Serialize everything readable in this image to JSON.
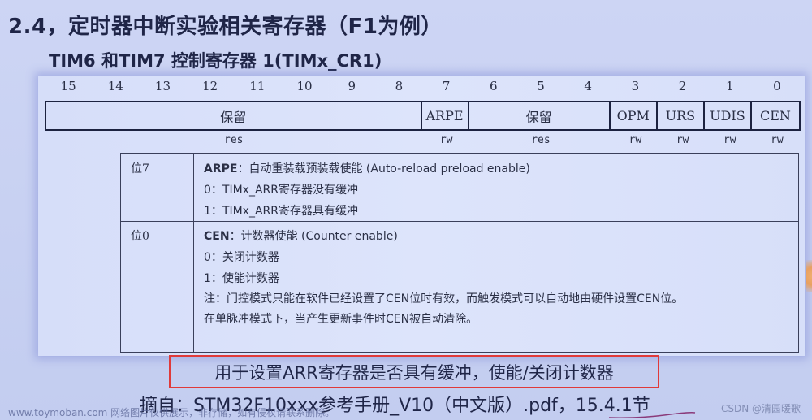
{
  "slide": {
    "title": "2.4，定时器中断实验相关寄存器（F1为例）",
    "subtitle": "TIM6 和TIM7 控制寄存器 1(TIMx_CR1)"
  },
  "register": {
    "bit_numbers": [
      "15",
      "14",
      "13",
      "12",
      "11",
      "10",
      "9",
      "8",
      "7",
      "6",
      "5",
      "4",
      "3",
      "2",
      "1",
      "0"
    ],
    "fields": [
      {
        "name": "保留",
        "bits": "15-8",
        "span": 8,
        "access": "res"
      },
      {
        "name": "ARPE",
        "bits": "7",
        "span": 1,
        "access": "rw"
      },
      {
        "name": "保留",
        "bits": "6-4",
        "span": 3,
        "access": "res"
      },
      {
        "name": "OPM",
        "bits": "3",
        "span": 1,
        "access": "rw"
      },
      {
        "name": "URS",
        "bits": "2",
        "span": 1,
        "access": "rw"
      },
      {
        "name": "UDIS",
        "bits": "1",
        "span": 1,
        "access": "rw"
      },
      {
        "name": "CEN",
        "bits": "0",
        "span": 1,
        "access": "rw"
      }
    ]
  },
  "descriptions": [
    {
      "label": "位7",
      "field": "ARPE",
      "heading": "：自动重装载预装载使能 (Auto-reload preload enable)",
      "lines": [
        "0：TIMx_ARR寄存器没有缓冲",
        "1：TIMx_ARR寄存器具有缓冲"
      ]
    },
    {
      "label": "位0",
      "field": "CEN",
      "heading": "：计数器使能 (Counter enable)",
      "lines": [
        "0：关闭计数器",
        "1：使能计数器"
      ],
      "note": "注：门控模式只能在软件已经设置了CEN位时有效，而触发模式可以自动地由硬件设置CEN位。",
      "extra": "在单脉冲模式下，当产生更新事件时CEN被自动清除。"
    }
  ],
  "highlight": {
    "text": "用于设置ARR寄存器是否具有缓冲，使能/关闭计数器",
    "border_color": "#e03a3a"
  },
  "source": {
    "text": "摘自：STM32F10xxx参考手册_V10（中文版）.pdf，15.4.1节"
  },
  "watermarks": {
    "left": "www.toymoban.com 网络图片仅供展示，非存储，如有侵权请联系删除。",
    "right": "CSDN @清园暖歌"
  },
  "colors": {
    "background": "#c8d1f2",
    "panel": "#dde4fb",
    "text": "#1f2547",
    "annotation_pen": "#8a3a7a"
  }
}
